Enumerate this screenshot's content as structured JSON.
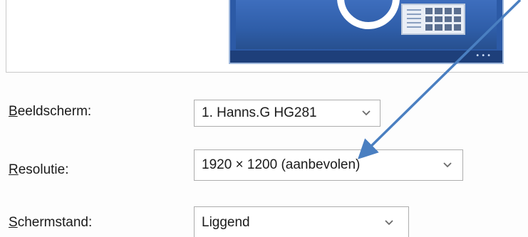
{
  "preview": {
    "monitor_dots": "•••",
    "accent_color": "#2c5aa6"
  },
  "form": {
    "display": {
      "label_mnemonic": "B",
      "label_rest": "eeldscherm:",
      "value": "1. Hanns.G HG281"
    },
    "resolution": {
      "label_mnemonic": "R",
      "label_rest": "esolutie:",
      "value": "1920 × 1200 (aanbevolen)"
    },
    "orientation": {
      "label_mnemonic": "S",
      "label_rest": "chermstand:",
      "value": "Liggend"
    }
  },
  "annotation": {
    "arrow_color": "#4a7fc1",
    "icon": "arrow-pointer-icon"
  }
}
